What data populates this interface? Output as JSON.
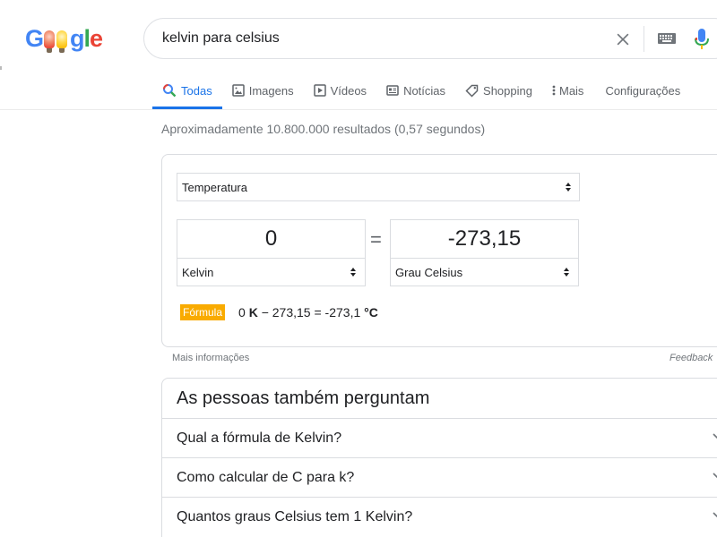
{
  "logo": {
    "text": "Google",
    "icon": "doodle-logo"
  },
  "search": {
    "query": "kelvin para celsius"
  },
  "tabs": [
    {
      "label": "Todas",
      "icon": "search-icon",
      "active": true
    },
    {
      "label": "Imagens",
      "icon": "image-icon"
    },
    {
      "label": "Vídeos",
      "icon": "play-icon"
    },
    {
      "label": "Notícias",
      "icon": "news-icon"
    },
    {
      "label": "Shopping",
      "icon": "tag-icon"
    },
    {
      "label": "Mais",
      "icon": "more-vertical-icon"
    },
    {
      "label": "Configurações"
    }
  ],
  "stats": "Aproximadamente 10.800.000 resultados (0,57 segundos)",
  "converter": {
    "category": "Temperatura",
    "from_value": "0",
    "from_unit": "Kelvin",
    "to_value": "-273,15",
    "to_unit": "Grau Celsius",
    "equals": "=",
    "formula_label": "Fórmula",
    "formula": {
      "p1": "0 ",
      "p2": "K",
      "p3": " − 273,15 = -273,1 ",
      "p4": "°C"
    }
  },
  "links": {
    "more_info": "Mais informações",
    "feedback": "Feedback"
  },
  "paa": {
    "title": "As pessoas também perguntam",
    "questions": [
      "Qual a fórmula de Kelvin?",
      "Como calcular de C para k?",
      "Quantos graus Celsius tem 1 Kelvin?"
    ]
  },
  "colors": {
    "accent": "#1a73e8",
    "formula_badge": "#f9ab00",
    "text": "#202124",
    "muted": "#70757a"
  }
}
